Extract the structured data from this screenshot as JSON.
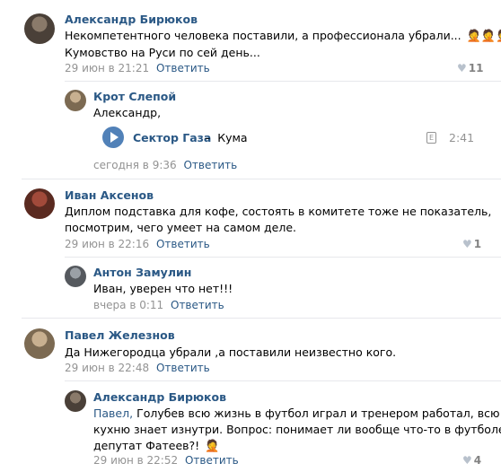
{
  "comments": [
    {
      "author": "Александр Бирюков",
      "line1": "Некомпетентного человека поставили, а профессионала убрали...",
      "emoji": "🤦🤦🤦",
      "line2": "Кумовство на Руси по сей день...",
      "date": "29 июн в 21:21",
      "reply": "Ответить",
      "likes": "11",
      "replies": [
        {
          "author": "Крот Слепой",
          "line1": "Александр,",
          "audio": {
            "artist": "Сектор Газа",
            "dash": "–",
            "title": "Кума",
            "explicit": "E",
            "duration": "2:41"
          },
          "date": "сегодня в 9:36",
          "reply": "Ответить"
        }
      ]
    },
    {
      "author": "Иван Аксенов",
      "line1": "Диплом подставка для кофе, состоять в комитете тоже не показатель,",
      "line2": "посмотрим, чего умеет на самом деле.",
      "date": "29 июн в 22:16",
      "reply": "Ответить",
      "likes": "1",
      "replies": [
        {
          "author": "Антон Замулин",
          "line1": "Иван, уверен что нет!!!",
          "date": "вчера в 0:11",
          "reply": "Ответить"
        }
      ]
    },
    {
      "author": "Павел Железнов",
      "line1": "Да Нижегородца убрали ,а поставили неизвестно кого.",
      "date": "29 июн в 22:48",
      "reply": "Ответить",
      "replies": [
        {
          "author": "Александр Бирюков",
          "reply_to": "Павел,",
          "line1": " Голубев всю жизнь в футбол играл и тренером работал, всю",
          "line2": "кухню знает изнутри. Вопрос: понимает ли вообще что-то в футболе",
          "line3": "депутат Фатеев?!",
          "emoji": "🤦",
          "date": "29 июн в 22:52",
          "reply": "Ответить",
          "likes": "4"
        }
      ]
    }
  ],
  "heart_icon": "♥"
}
